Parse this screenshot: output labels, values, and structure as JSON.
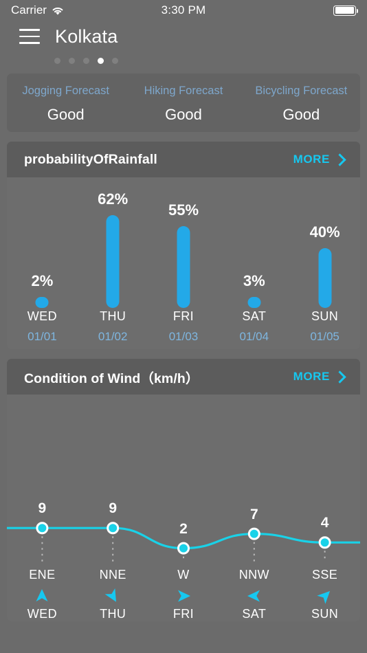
{
  "statusbar": {
    "carrier": "Carrier",
    "time": "3:30 PM",
    "wifi_icon": "wifi-icon",
    "battery_icon": "battery-full-icon"
  },
  "navbar": {
    "menu_icon": "hamburger-menu-icon",
    "city": "Kolkata"
  },
  "pager": {
    "count": 5,
    "active_index": 3
  },
  "activity_forecast": {
    "items": [
      {
        "name": "Jogging Forecast",
        "value": "Good"
      },
      {
        "name": "Hiking Forecast",
        "value": "Good"
      },
      {
        "name": "Bicycling Forecast",
        "value": "Good"
      }
    ]
  },
  "rain_card": {
    "title": "probabilityOfRainfall",
    "more_label": "MORE",
    "more_icon": "chevron-right-icon"
  },
  "wind_card": {
    "title": "Condition of Wind（km/h）",
    "more_label": "MORE",
    "more_icon": "chevron-right-icon"
  },
  "colors": {
    "page_bg": "#6b6b6b",
    "card_header_bg": "#5c5c5c",
    "card_body_bg": "#6d6d6d",
    "accent_cyan": "#16c8f0",
    "bar_blue": "#23a9e8",
    "line_cyan": "#19d2e8",
    "date_blue": "#7eb6e0",
    "activity_label_blue": "#7ea7cc"
  },
  "chart_data": [
    {
      "type": "bar",
      "title": "probabilityOfRainfall",
      "categories": [
        "WED",
        "THU",
        "FRI",
        "SAT",
        "SUN"
      ],
      "dates": [
        "01/01",
        "01/02",
        "01/03",
        "01/04",
        "01/05"
      ],
      "values": [
        2,
        62,
        55,
        3,
        40
      ],
      "labels": [
        "2%",
        "62%",
        "55%",
        "3%",
        "40%"
      ],
      "unit": "%",
      "xlabel": "",
      "ylabel": "",
      "ylim": [
        0,
        100
      ],
      "grid": false,
      "legend": "none"
    },
    {
      "type": "line",
      "title": "Condition of Wind（km/h）",
      "categories": [
        "WED",
        "THU",
        "FRI",
        "SAT",
        "SUN"
      ],
      "dates": [
        "01/01",
        "01/02",
        "01/03",
        "01/04",
        "01/05"
      ],
      "values": [
        9,
        9,
        2,
        7,
        4
      ],
      "labels": [
        "9",
        "9",
        "2",
        "7",
        "4"
      ],
      "directions": [
        "ENE",
        "NNE",
        "W",
        "NNW",
        "SSE"
      ],
      "direction_icons": [
        "arrow-up-icon",
        "arrow-down-right-icon",
        "arrow-right-icon",
        "arrow-left-icon",
        "arrow-up-right-icon"
      ],
      "direction_angles": [
        0,
        150,
        90,
        270,
        45
      ],
      "unit": "km/h",
      "xlabel": "",
      "ylabel": "",
      "ylim": [
        0,
        10
      ],
      "grid": false,
      "legend": "none"
    }
  ]
}
